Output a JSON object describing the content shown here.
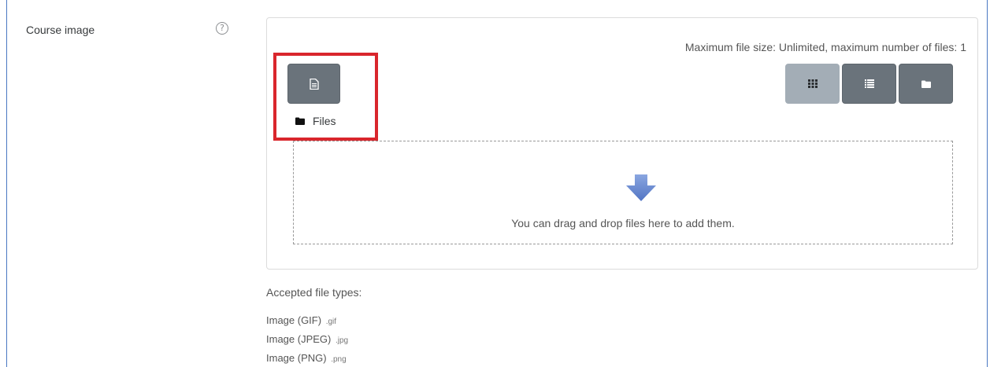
{
  "field": {
    "label": "Course image",
    "help_icon": "question-circle-icon"
  },
  "filepicker": {
    "max_size_text": "Maximum file size: Unlimited, maximum number of files: 1",
    "add_button_icon": "file-add-icon",
    "folder_label": "Files",
    "view_buttons": [
      {
        "name": "icons-view",
        "icon": "grid-icon",
        "active": true
      },
      {
        "name": "list-view",
        "icon": "list-icon",
        "active": false
      },
      {
        "name": "tree-view",
        "icon": "folder-icon",
        "active": false
      }
    ],
    "drop_text": "You can drag and drop files here to add them."
  },
  "accepted": {
    "title": "Accepted file types:",
    "types": [
      {
        "label": "Image (GIF)",
        "ext": ".gif"
      },
      {
        "label": "Image (JPEG)",
        "ext": ".jpg"
      },
      {
        "label": "Image (PNG)",
        "ext": ".png"
      }
    ]
  },
  "colors": {
    "highlight": "#d9262c",
    "button": "#6a737b",
    "button_active": "#a3adb6",
    "arrow": "#6f8fd4"
  }
}
